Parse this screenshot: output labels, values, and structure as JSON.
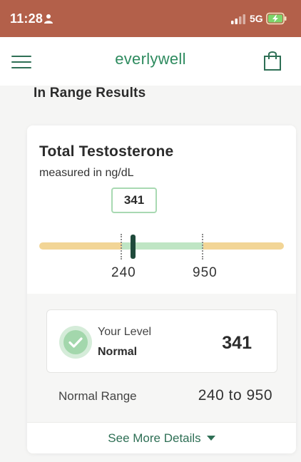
{
  "status_bar": {
    "time": "11:28",
    "network": "5G"
  },
  "header": {
    "brand": "everlywell",
    "icons": [
      "hamburger-menu-icon",
      "shopping-bag-icon"
    ]
  },
  "section": {
    "title": "In Range Results"
  },
  "result_card": {
    "title": "Total Testosterone",
    "unit_text": "measured in ng/dL",
    "marker_value": "341",
    "range_low_label": "240",
    "range_high_label": "950",
    "level_value": 341,
    "range_low": 240,
    "range_high": 950,
    "your_level_label": "Your Level",
    "status": "Normal",
    "level_number": "341",
    "normal_range_label": "Normal Range",
    "normal_range_value": "240 to 950",
    "see_more_label": "See More Details",
    "colors": {
      "low_high_zone": "#f2d596",
      "normal_zone": "#bfe5c4",
      "marker": "#1f4a3b",
      "accent": "#2e6f55"
    }
  },
  "colors": {
    "status_bar": "#b3604a",
    "brand": "#2e8b5f"
  }
}
